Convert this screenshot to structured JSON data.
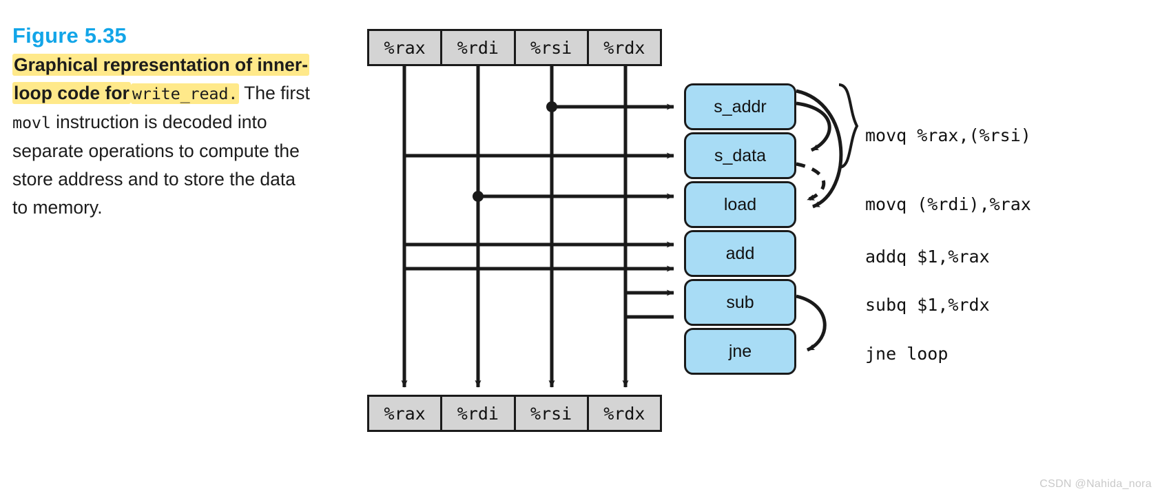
{
  "figure": {
    "number_label": "Figure 5.35",
    "caption_highlight_1": "Graphical representation of inner-loop code for",
    "caption_highlight_code": "write_read.",
    "caption_rest_1": "The first",
    "caption_mono_2": "movl",
    "caption_rest_2": "instruction is decoded into separate operations to compute the store address and to store the data to memory.",
    "accent_color": "#12a5e8",
    "highlight_color": "#ffe98a",
    "opbox_color": "#a8dcf5",
    "regfile_color": "#d4d4d4"
  },
  "registers_top": [
    {
      "name": "%rax"
    },
    {
      "name": "%rdi"
    },
    {
      "name": "%rsi"
    },
    {
      "name": "%rdx"
    }
  ],
  "registers_bottom": [
    {
      "name": "%rax"
    },
    {
      "name": "%rdi"
    },
    {
      "name": "%rsi"
    },
    {
      "name": "%rdx"
    }
  ],
  "operations": [
    {
      "label": "s_addr"
    },
    {
      "label": "s_data"
    },
    {
      "label": "load"
    },
    {
      "label": "add"
    },
    {
      "label": "sub"
    },
    {
      "label": "jne"
    }
  ],
  "assembly": [
    {
      "text": "movq %rax,(%rsi)"
    },
    {
      "text": "movq (%rdi),%rax"
    },
    {
      "text": "addq $1,%rax"
    },
    {
      "text": "subq $1,%rdx"
    },
    {
      "text": "jne loop"
    }
  ],
  "watermark": {
    "text": "CSDN @Nahida_nora"
  }
}
